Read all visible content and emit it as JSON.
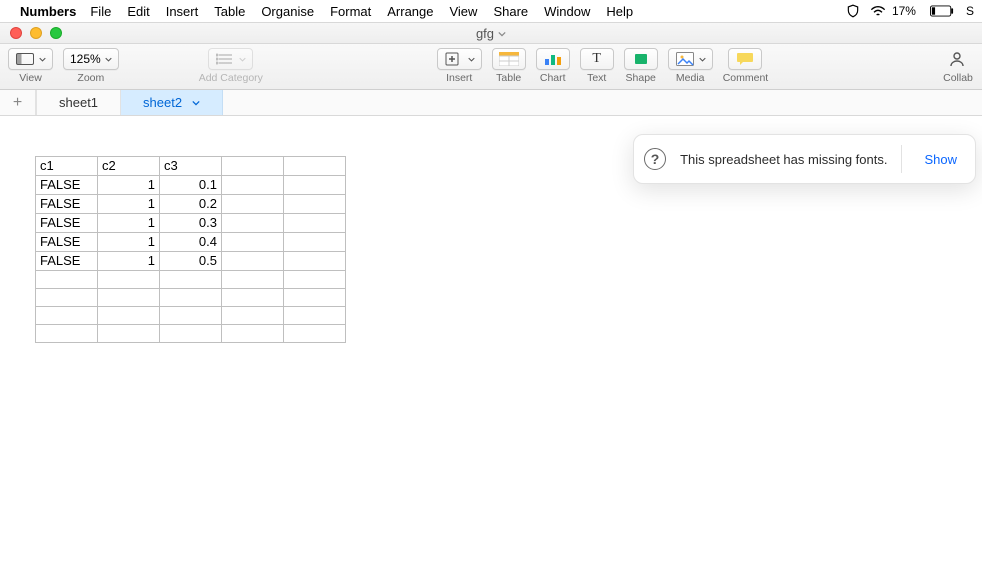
{
  "menubar": {
    "apple": "",
    "appname": "Numbers",
    "items": [
      "File",
      "Edit",
      "Insert",
      "Table",
      "Organise",
      "Format",
      "Arrange",
      "View",
      "Share",
      "Window",
      "Help"
    ],
    "battery_pct": "17%",
    "right_letter": "S"
  },
  "titlebar": {
    "doc_title": "gfg"
  },
  "toolbar": {
    "view_label": "View",
    "zoom_label": "Zoom",
    "zoom_value": "125%",
    "add_category_label": "Add Category",
    "insert_label": "Insert",
    "table_label": "Table",
    "chart_label": "Chart",
    "text_label": "Text",
    "shape_label": "Shape",
    "media_label": "Media",
    "comment_label": "Comment",
    "collab_label": "Collab"
  },
  "sheets": {
    "tabs": [
      {
        "label": "sheet1",
        "active": false
      },
      {
        "label": "sheet2",
        "active": true
      }
    ]
  },
  "table": {
    "headers": [
      "c1",
      "c2",
      "c3",
      "",
      ""
    ],
    "rows": [
      [
        "FALSE",
        "1",
        "0.1",
        "",
        ""
      ],
      [
        "FALSE",
        "1",
        "0.2",
        "",
        ""
      ],
      [
        "FALSE",
        "1",
        "0.3",
        "",
        ""
      ],
      [
        "FALSE",
        "1",
        "0.4",
        "",
        ""
      ],
      [
        "FALSE",
        "1",
        "0.5",
        "",
        ""
      ],
      [
        "",
        "",
        "",
        "",
        ""
      ],
      [
        "",
        "",
        "",
        "",
        ""
      ],
      [
        "",
        "",
        "",
        "",
        ""
      ],
      [
        "",
        "",
        "",
        "",
        ""
      ]
    ],
    "align": [
      "txt",
      "num",
      "num",
      "txt",
      "txt"
    ]
  },
  "notice": {
    "message": "This spreadsheet has missing fonts.",
    "action": "Show"
  }
}
